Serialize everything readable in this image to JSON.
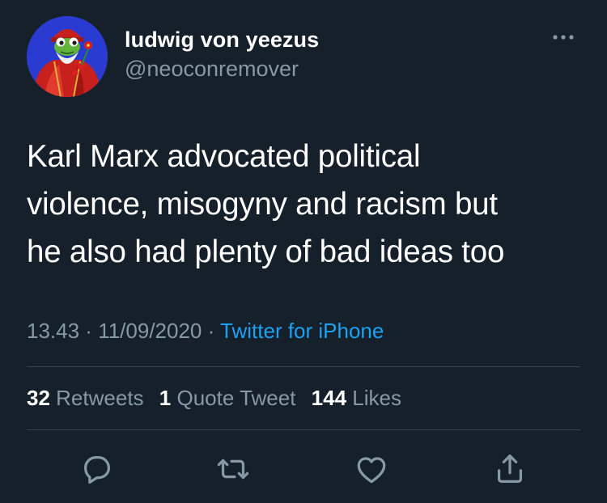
{
  "author": {
    "display_name": "ludwig von yeezus",
    "handle": "@neoconremover",
    "avatar_icon": "cartoon-frog-avatar-icon"
  },
  "tweet": {
    "lines": [
      "Karl Marx advocated political",
      "violence, misogyny and racism but",
      "he also had plenty of bad ideas too"
    ],
    "time": "13.43",
    "sep1": " · ",
    "date": "11/09/2020",
    "sep2": " · ",
    "source": "Twitter for iPhone"
  },
  "stats": {
    "retweets_count": "32",
    "retweets_label": "Retweets",
    "quotes_count": "1",
    "quotes_label": "Quote Tweet",
    "likes_count": "144",
    "likes_label": "Likes"
  },
  "actions": {
    "reply_icon": "reply-icon",
    "retweet_icon": "retweet-icon",
    "like_icon": "like-icon",
    "share_icon": "share-icon"
  },
  "theme": {
    "background": "#15202b",
    "primary_text": "#ffffff",
    "secondary_text": "#8899a6",
    "link": "#1da1f2",
    "divider": "#38444d"
  }
}
